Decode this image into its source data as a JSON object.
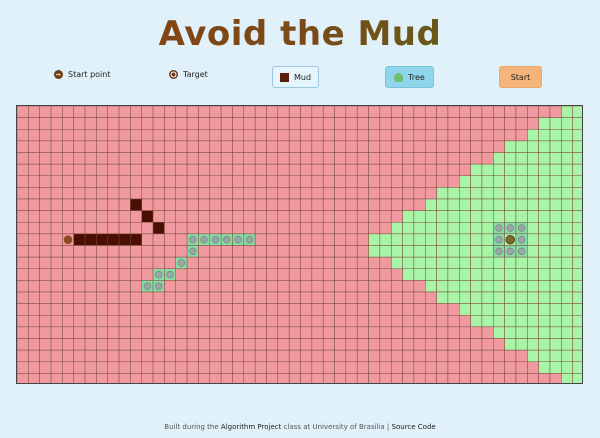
{
  "title": "Avoid the Mud",
  "legend": {
    "start": "Start point",
    "target": "Target"
  },
  "buttons": {
    "mud": "Mud",
    "tree": "Tree",
    "start": "Start"
  },
  "grid": {
    "cols": 50,
    "rows": 24,
    "colors": {
      "red": "#f09aa0",
      "green": "#a9f5a8",
      "mud": "#4a0e02",
      "tree": "#88dba4",
      "line": "#7a4a3a",
      "start": "#8a4b1d"
    },
    "start": [
      4,
      11
    ],
    "target": [
      43,
      11
    ],
    "mud": [
      [
        10,
        8
      ],
      [
        11,
        9
      ],
      [
        12,
        10
      ],
      [
        5,
        11
      ],
      [
        6,
        11
      ],
      [
        7,
        11
      ],
      [
        8,
        11
      ],
      [
        9,
        11
      ],
      [
        10,
        11
      ]
    ],
    "trees": [
      [
        15,
        11
      ],
      [
        16,
        11
      ],
      [
        17,
        11
      ],
      [
        18,
        11
      ],
      [
        19,
        11
      ],
      [
        20,
        11
      ],
      [
        15,
        12
      ],
      [
        14,
        13
      ],
      [
        13,
        14
      ],
      [
        12,
        14
      ],
      [
        11,
        15
      ],
      [
        12,
        15
      ],
      [
        42,
        10
      ],
      [
        43,
        10
      ],
      [
        44,
        10
      ],
      [
        42,
        11
      ],
      [
        44,
        11
      ],
      [
        42,
        12
      ],
      [
        43,
        12
      ],
      [
        44,
        12
      ]
    ]
  },
  "footer": {
    "prefix": "Built during the ",
    "project": "Algorithm Project",
    "middle": " class at University of Brasilia | ",
    "source": "Source Code"
  }
}
